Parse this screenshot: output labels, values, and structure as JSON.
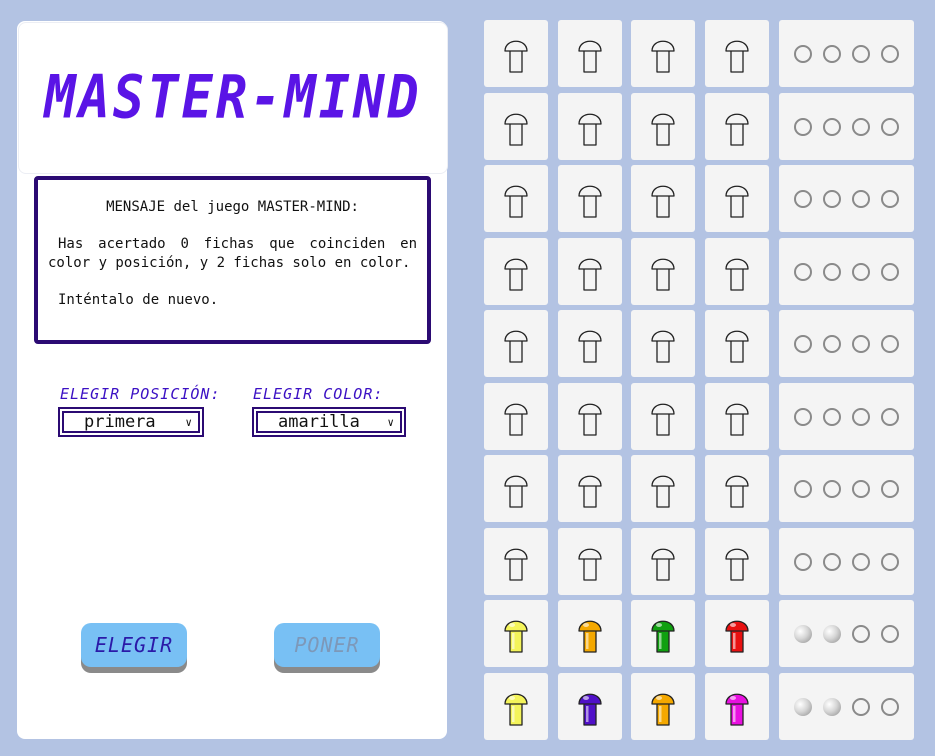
{
  "title": "MASTER-MIND",
  "message": {
    "heading": "MENSAJE del juego MASTER-MIND:",
    "body": "Has acertado 0 fichas que coinciden en color y posición, y 2 fichas solo en color.",
    "retry": "Inténtalo de nuevo."
  },
  "position_select": {
    "label": "ELEGIR POSICIÓN:",
    "value": "primera"
  },
  "color_select": {
    "label": "ELEGIR COLOR:",
    "value": "amarilla"
  },
  "buttons": {
    "elegir": "ELEGIR",
    "poner": "PONER"
  },
  "colors": {
    "amarilla": "#f4f45a",
    "naranja": "#f4a800",
    "verde": "#10a010",
    "roja": "#e81010",
    "morada": "#5010c8",
    "rosa": "#e810e0",
    "vacia": "none"
  },
  "rows": [
    {
      "pieces": [
        "vacia",
        "vacia",
        "vacia",
        "vacia"
      ],
      "hints": [
        "empty",
        "empty",
        "empty",
        "empty"
      ]
    },
    {
      "pieces": [
        "vacia",
        "vacia",
        "vacia",
        "vacia"
      ],
      "hints": [
        "empty",
        "empty",
        "empty",
        "empty"
      ]
    },
    {
      "pieces": [
        "vacia",
        "vacia",
        "vacia",
        "vacia"
      ],
      "hints": [
        "empty",
        "empty",
        "empty",
        "empty"
      ]
    },
    {
      "pieces": [
        "vacia",
        "vacia",
        "vacia",
        "vacia"
      ],
      "hints": [
        "empty",
        "empty",
        "empty",
        "empty"
      ]
    },
    {
      "pieces": [
        "vacia",
        "vacia",
        "vacia",
        "vacia"
      ],
      "hints": [
        "empty",
        "empty",
        "empty",
        "empty"
      ]
    },
    {
      "pieces": [
        "vacia",
        "vacia",
        "vacia",
        "vacia"
      ],
      "hints": [
        "empty",
        "empty",
        "empty",
        "empty"
      ]
    },
    {
      "pieces": [
        "vacia",
        "vacia",
        "vacia",
        "vacia"
      ],
      "hints": [
        "empty",
        "empty",
        "empty",
        "empty"
      ]
    },
    {
      "pieces": [
        "vacia",
        "vacia",
        "vacia",
        "vacia"
      ],
      "hints": [
        "empty",
        "empty",
        "empty",
        "empty"
      ]
    },
    {
      "pieces": [
        "amarilla",
        "naranja",
        "verde",
        "roja"
      ],
      "hints": [
        "white",
        "white",
        "empty",
        "empty"
      ]
    },
    {
      "pieces": [
        "amarilla",
        "morada",
        "naranja",
        "rosa"
      ],
      "hints": [
        "white",
        "white",
        "empty",
        "empty"
      ]
    }
  ]
}
